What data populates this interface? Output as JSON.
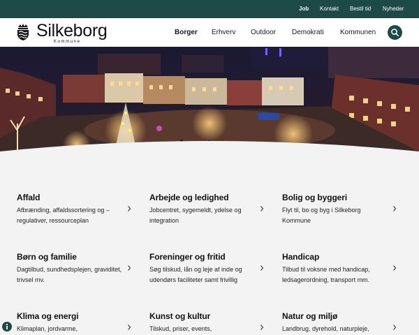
{
  "topbar": {
    "links": [
      "Job",
      "Kontakt",
      "Bestil tid",
      "Nyheder"
    ]
  },
  "header": {
    "logo_word": "Silkeborg",
    "logo_sub": "Kommune",
    "nav": [
      "Borger",
      "Erhverv",
      "Outdoor",
      "Demokrati",
      "Kommunen"
    ],
    "active_nav": "Borger"
  },
  "colors": {
    "brand_dark_green": "#1d4a47",
    "page_background": "#f3f3f3"
  },
  "cards": [
    {
      "title": "Affald",
      "desc": "Afbrænding, affaldssortering og –regulativer, ressourceplan"
    },
    {
      "title": "Arbejde og ledighed",
      "desc": "Jobcentret, sygemeldt, ydelse og integration"
    },
    {
      "title": "Bolig og byggeri",
      "desc": "Flyt til, bo og byg i Silkeborg Kommune"
    },
    {
      "title": "Børn og familie",
      "desc": "Dagtilbud, sundhedsplejen, graviditet, trivsel mv."
    },
    {
      "title": "Foreninger og fritid",
      "desc": "Søg tilskud, lån og leje af inde og udendørs faciliteter samt frivillig"
    },
    {
      "title": "Handicap",
      "desc": "Tilbud til voksne med handicap, ledsagerordning, transport mm."
    },
    {
      "title": "Klima og energi",
      "desc": "Klimaplan, jordvarme,"
    },
    {
      "title": "Kunst og kultur",
      "desc": "Tilskud, priser, events,"
    },
    {
      "title": "Natur og miljø",
      "desc": "Landbrug, dyrehold, naturpleje,"
    }
  ],
  "icons": {
    "search": "search-icon",
    "chevron": "chevron-right-icon",
    "info": "info-icon",
    "logo": "crest-icon"
  }
}
